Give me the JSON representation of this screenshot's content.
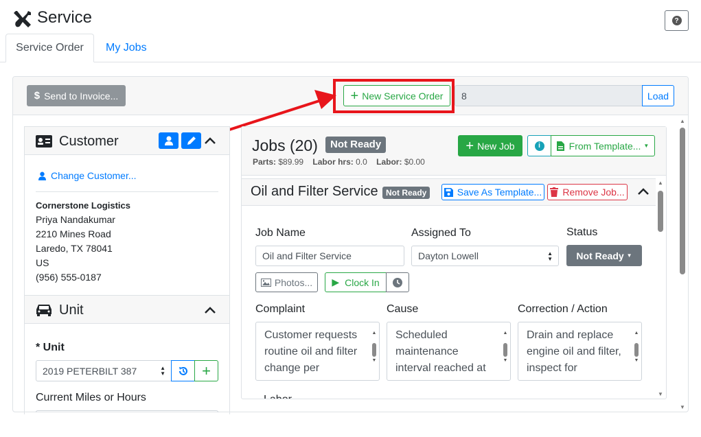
{
  "app": {
    "title": "Service",
    "help_label": "?"
  },
  "tabs": [
    {
      "label": "Service Order",
      "active": true
    },
    {
      "label": "My Jobs",
      "active": false
    }
  ],
  "toolbar": {
    "send_to_invoice": "Send to Invoice...",
    "new_service_order": "New Service Order",
    "order_number": "8",
    "load": "Load"
  },
  "customer": {
    "title": "Customer",
    "change": "Change Customer...",
    "name": "Cornerstone Logistics",
    "contact": "Priya Nandakumar",
    "street": "2210 Mines Road",
    "city": "Laredo, TX 78041",
    "country": "US",
    "phone": "(956) 555-0187"
  },
  "unit": {
    "title": "Unit",
    "unit_label": "* Unit",
    "unit_value": "2019 PETERBILT 387",
    "miles_label": "Current Miles or Hours"
  },
  "jobs": {
    "title": "Jobs (20)",
    "status": "Not Ready",
    "parts_label": "Parts:",
    "parts_value": "$89.99",
    "labor_hrs_label": "Labor hrs:",
    "labor_hrs_value": "0.0",
    "labor_label": "Labor:",
    "labor_value": "$0.00",
    "new_job": "New Job",
    "from_template": "From Template..."
  },
  "job": {
    "title": "Oil and Filter Service",
    "status_badge": "Not Ready",
    "save_template": "Save As Template...",
    "remove": "Remove Job...",
    "name_label": "Job Name",
    "name_value": "Oil and Filter Service",
    "assigned_label": "Assigned To",
    "assigned_value": "Dayton Lowell",
    "status_label": "Status",
    "status_value": "Not Ready",
    "photos": "Photos...",
    "clock_in": "Clock In",
    "complaint_label": "Complaint",
    "complaint_text": "Customer requests routine oil and filter change per",
    "cause_label": "Cause",
    "cause_text": "Scheduled maintenance interval reached at",
    "correction_label": "Correction / Action",
    "correction_text": "Drain and replace engine oil and filter, inspect for",
    "labor_label_partial": "Labor"
  },
  "colors": {
    "primary": "#007bff",
    "success": "#28a745",
    "secondary": "#6c757d",
    "danger": "#dc3545",
    "highlight": "#e8151b"
  }
}
